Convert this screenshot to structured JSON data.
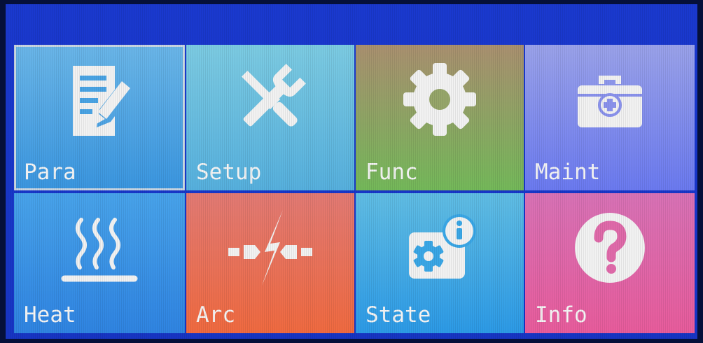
{
  "menu": {
    "tiles": [
      {
        "label": "Para",
        "icon": "edit-document-icon",
        "selected": true
      },
      {
        "label": "Setup",
        "icon": "wrench-screwdriver-icon"
      },
      {
        "label": "Func",
        "icon": "gear-icon"
      },
      {
        "label": "Maint",
        "icon": "first-aid-toolbox-icon"
      },
      {
        "label": "Heat",
        "icon": "heat-waves-icon"
      },
      {
        "label": "Arc",
        "icon": "lightning-arc-icon"
      },
      {
        "label": "State",
        "icon": "gear-info-icon"
      },
      {
        "label": "Info",
        "icon": "question-mark-icon"
      }
    ]
  },
  "colors": {
    "background": "#1a39cf",
    "icon": "#f2f2f2",
    "selection_border": "#c8d6e2"
  }
}
